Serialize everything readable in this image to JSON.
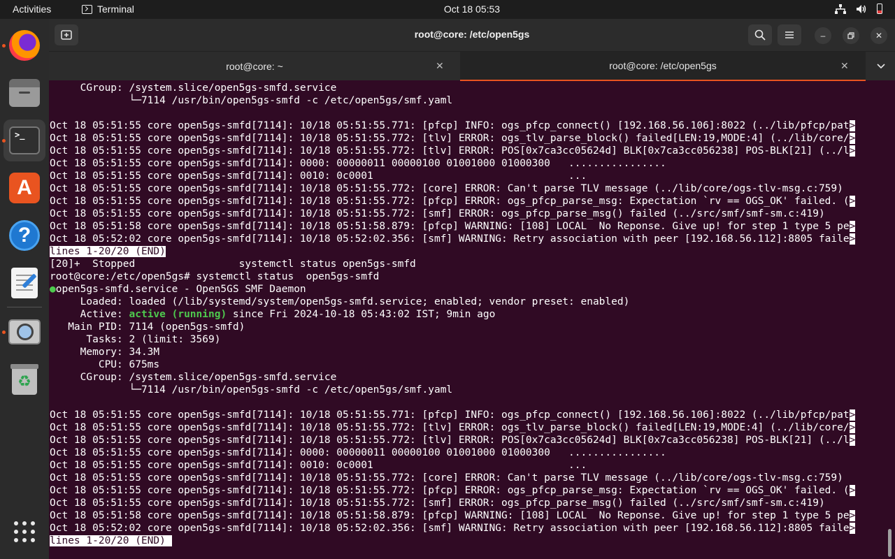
{
  "topbar": {
    "activities": "Activities",
    "app_name": "Terminal",
    "clock": "Oct 18  05:53"
  },
  "dock": {
    "items": [
      "Firefox",
      "Files",
      "Terminal",
      "Ubuntu Software",
      "Help",
      "Text Editor",
      "Image Viewer",
      "Trash",
      "Show Applications"
    ]
  },
  "window": {
    "title": "root@core: /etc/open5gs",
    "tabs": [
      {
        "label": "root@core: ~"
      },
      {
        "label": "root@core: /etc/open5gs"
      }
    ]
  },
  "terminal": {
    "lines": [
      {
        "text": "     CGroup: /system.slice/open5gs-smfd.service"
      },
      {
        "text": "             └─7114 /usr/bin/open5gs-smfd -c /etc/open5gs/smf.yaml"
      },
      {
        "text": ""
      },
      {
        "text": "Oct 18 05:51:55 core open5gs-smfd[7114]: 10/18 05:51:55.771: [pfcp] INFO: ogs_pfcp_connect() [192.168.56.106]:8022 (../lib/pfcp/pat",
        "trunc": ">"
      },
      {
        "text": "Oct 18 05:51:55 core open5gs-smfd[7114]: 10/18 05:51:55.772: [tlv] ERROR: ogs_tlv_parse_block() failed[LEN:19,MODE:4] (../lib/core/",
        "trunc": ">"
      },
      {
        "text": "Oct 18 05:51:55 core open5gs-smfd[7114]: 10/18 05:51:55.772: [tlv] ERROR: POS[0x7ca3cc05624d] BLK[0x7ca3cc056238] POS-BLK[21] (../l",
        "trunc": ">"
      },
      {
        "text": "Oct 18 05:51:55 core open5gs-smfd[7114]: 0000: 00000011 00000100 01001000 01000300   ................"
      },
      {
        "text": "Oct 18 05:51:55 core open5gs-smfd[7114]: 0010: 0c0001                                ..."
      },
      {
        "text": "Oct 18 05:51:55 core open5gs-smfd[7114]: 10/18 05:51:55.772: [core] ERROR: Can't parse TLV message (../lib/core/ogs-tlv-msg.c:759)"
      },
      {
        "text": "Oct 18 05:51:55 core open5gs-smfd[7114]: 10/18 05:51:55.772: [pfcp] ERROR: ogs_pfcp_parse_msg: Expectation `rv == OGS_OK' failed. (",
        "trunc": ">"
      },
      {
        "text": "Oct 18 05:51:55 core open5gs-smfd[7114]: 10/18 05:51:55.772: [smf] ERROR: ogs_pfcp_parse_msg() failed (../src/smf/smf-sm.c:419)"
      },
      {
        "text": "Oct 18 05:51:58 core open5gs-smfd[7114]: 10/18 05:51:58.879: [pfcp] WARNING: [108] LOCAL  No Reponse. Give up! for step 1 type 5 pe",
        "trunc": ">"
      },
      {
        "text": "Oct 18 05:52:02 core open5gs-smfd[7114]: 10/18 05:52:02.356: [smf] WARNING: Retry association with peer [192.168.56.112]:8805 faile",
        "trunc": ">"
      },
      {
        "text": "lines 1-20/20 (END)",
        "style": "hl"
      },
      {
        "text": "[20]+  Stopped                 systemctl status open5gs-smfd"
      },
      {
        "text": "root@core:/etc/open5gs# systemctl status  open5gs-smfd"
      },
      {
        "text": "open5gs-smfd.service - Open5GS SMF Daemon",
        "style": "dot"
      },
      {
        "text": "     Loaded: loaded (/lib/systemd/system/open5gs-smfd.service; enabled; vendor preset: enabled)"
      },
      {
        "text": "     Active: ",
        "green": "active (running)",
        "rest": " since Fri 2024-10-18 05:43:02 IST; 9min ago"
      },
      {
        "text": "   Main PID: 7114 (open5gs-smfd)"
      },
      {
        "text": "      Tasks: 2 (limit: 3569)"
      },
      {
        "text": "     Memory: 34.3M"
      },
      {
        "text": "        CPU: 675ms"
      },
      {
        "text": "     CGroup: /system.slice/open5gs-smfd.service"
      },
      {
        "text": "             └─7114 /usr/bin/open5gs-smfd -c /etc/open5gs/smf.yaml"
      },
      {
        "text": ""
      },
      {
        "text": "Oct 18 05:51:55 core open5gs-smfd[7114]: 10/18 05:51:55.771: [pfcp] INFO: ogs_pfcp_connect() [192.168.56.106]:8022 (../lib/pfcp/pat",
        "trunc": ">"
      },
      {
        "text": "Oct 18 05:51:55 core open5gs-smfd[7114]: 10/18 05:51:55.772: [tlv] ERROR: ogs_tlv_parse_block() failed[LEN:19,MODE:4] (../lib/core/",
        "trunc": ">"
      },
      {
        "text": "Oct 18 05:51:55 core open5gs-smfd[7114]: 10/18 05:51:55.772: [tlv] ERROR: POS[0x7ca3cc05624d] BLK[0x7ca3cc056238] POS-BLK[21] (../l",
        "trunc": ">"
      },
      {
        "text": "Oct 18 05:51:55 core open5gs-smfd[7114]: 0000: 00000011 00000100 01001000 01000300   ................"
      },
      {
        "text": "Oct 18 05:51:55 core open5gs-smfd[7114]: 0010: 0c0001                                ..."
      },
      {
        "text": "Oct 18 05:51:55 core open5gs-smfd[7114]: 10/18 05:51:55.772: [core] ERROR: Can't parse TLV message (../lib/core/ogs-tlv-msg.c:759)"
      },
      {
        "text": "Oct 18 05:51:55 core open5gs-smfd[7114]: 10/18 05:51:55.772: [pfcp] ERROR: ogs_pfcp_parse_msg: Expectation `rv == OGS_OK' failed. (",
        "trunc": ">"
      },
      {
        "text": "Oct 18 05:51:55 core open5gs-smfd[7114]: 10/18 05:51:55.772: [smf] ERROR: ogs_pfcp_parse_msg() failed (../src/smf/smf-sm.c:419)"
      },
      {
        "text": "Oct 18 05:51:58 core open5gs-smfd[7114]: 10/18 05:51:58.879: [pfcp] WARNING: [108] LOCAL  No Reponse. Give up! for step 1 type 5 pe",
        "trunc": ">"
      },
      {
        "text": "Oct 18 05:52:02 core open5gs-smfd[7114]: 10/18 05:52:02.356: [smf] WARNING: Retry association with peer [192.168.56.112]:8805 faile",
        "trunc": ">"
      },
      {
        "text": "lines 1-20/20 (END) ",
        "style": "hl"
      }
    ]
  },
  "colors": {
    "terminal_bg": "#300a24",
    "accent": "#e95420",
    "active_green": "#4ec94e"
  }
}
